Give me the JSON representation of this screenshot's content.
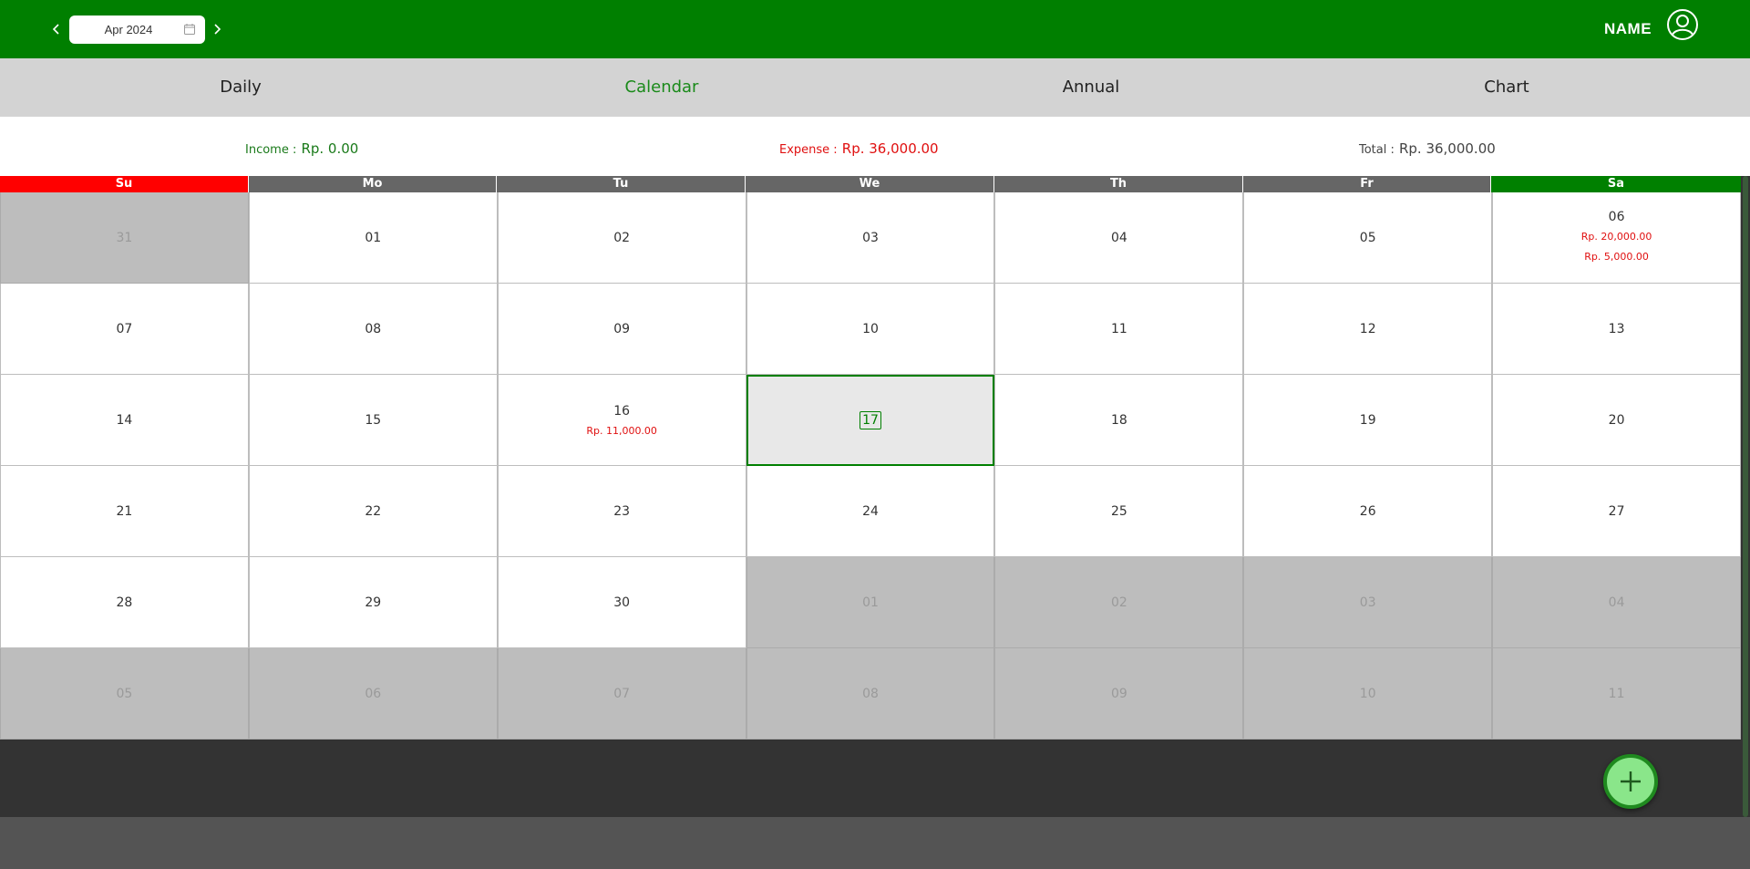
{
  "header": {
    "month": "Apr 2024",
    "user_name": "NAME"
  },
  "tabs": [
    {
      "label": "Daily",
      "active": false
    },
    {
      "label": "Calendar",
      "active": true
    },
    {
      "label": "Annual",
      "active": false
    },
    {
      "label": "Chart",
      "active": false
    }
  ],
  "summary": {
    "income_label": "Income :",
    "income_value": "Rp. 0.00",
    "expense_label": "Expense :",
    "expense_value": "Rp. 36,000.00",
    "total_label": "Total :",
    "total_value": "Rp. 36,000.00"
  },
  "calendar": {
    "weekdays": [
      "Su",
      "Mo",
      "Tu",
      "We",
      "Th",
      "Fr",
      "Sa"
    ],
    "weeks": [
      [
        {
          "day": "31",
          "other": true
        },
        {
          "day": "01"
        },
        {
          "day": "02"
        },
        {
          "day": "03"
        },
        {
          "day": "04"
        },
        {
          "day": "05"
        },
        {
          "day": "06",
          "entries": [
            "Rp. 20,000.00",
            "Rp. 5,000.00"
          ]
        }
      ],
      [
        {
          "day": "07"
        },
        {
          "day": "08"
        },
        {
          "day": "09"
        },
        {
          "day": "10"
        },
        {
          "day": "11"
        },
        {
          "day": "12"
        },
        {
          "day": "13"
        }
      ],
      [
        {
          "day": "14"
        },
        {
          "day": "15"
        },
        {
          "day": "16",
          "entries": [
            "Rp. 11,000.00"
          ]
        },
        {
          "day": "17",
          "today": true
        },
        {
          "day": "18"
        },
        {
          "day": "19"
        },
        {
          "day": "20"
        }
      ],
      [
        {
          "day": "21"
        },
        {
          "day": "22"
        },
        {
          "day": "23"
        },
        {
          "day": "24"
        },
        {
          "day": "25"
        },
        {
          "day": "26"
        },
        {
          "day": "27"
        }
      ],
      [
        {
          "day": "28"
        },
        {
          "day": "29"
        },
        {
          "day": "30"
        },
        {
          "day": "01",
          "other": true
        },
        {
          "day": "02",
          "other": true
        },
        {
          "day": "03",
          "other": true
        },
        {
          "day": "04",
          "other": true
        }
      ],
      [
        {
          "day": "05",
          "other": true
        },
        {
          "day": "06",
          "other": true
        },
        {
          "day": "07",
          "other": true
        },
        {
          "day": "08",
          "other": true
        },
        {
          "day": "09",
          "other": true
        },
        {
          "day": "10",
          "other": true
        },
        {
          "day": "11",
          "other": true
        }
      ]
    ]
  },
  "icons": {
    "prev": "chevron-left-icon",
    "next": "chevron-right-icon",
    "calendar": "calendar-icon",
    "user": "user-circle-icon",
    "add": "plus-icon"
  },
  "colors": {
    "brand": "#007f00",
    "expense": "#e01010",
    "income": "#1a7a1a",
    "sunday": "#ff0000",
    "saturday": "#008000"
  }
}
